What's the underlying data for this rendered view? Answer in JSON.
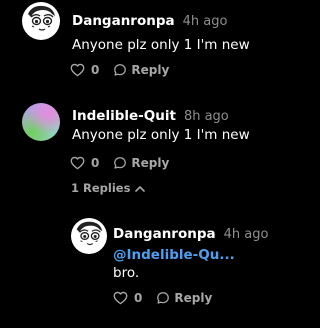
{
  "comments": [
    {
      "username": "Danganronpa",
      "time": "4h ago",
      "text": "Anyone plz only 1 I'm new",
      "likes": "0",
      "reply_label": "Reply",
      "avatar_icon": "cartoon-face-avatar"
    },
    {
      "username": "Indelible-Quit",
      "time": "8h ago",
      "text": "Anyone plz only 1 I'm new",
      "likes": "0",
      "reply_label": "Reply",
      "avatar_icon": "gradient-avatar",
      "replies_toggle": "1 Replies"
    }
  ],
  "reply": {
    "username": "Danganronpa",
    "time": "4h ago",
    "mention": "@Indelible-Qu...",
    "text": "bro.",
    "likes": "0",
    "reply_label": "Reply",
    "avatar_icon": "cartoon-face-avatar"
  },
  "colors": {
    "background": "#000000",
    "text": "#ffffff",
    "muted": "#8e8e8e",
    "mention": "#4f9ff0"
  }
}
